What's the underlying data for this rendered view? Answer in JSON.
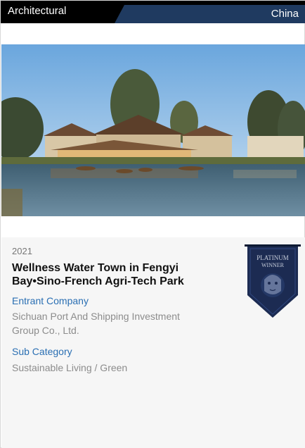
{
  "header": {
    "category": "Architectural",
    "country": "China"
  },
  "entry": {
    "year": "2021",
    "title": "Wellness Water Town in Fengyi Bay•Sino-French Agri-Tech Park",
    "entrant_label": "Entrant Company",
    "entrant_value": "Sichuan Port And Shipping Investment Group Co., Ltd.",
    "subcategory_label": "Sub Category",
    "subcategory_value": "Sustainable Living / Green"
  },
  "badge": {
    "line1": "PLATINUM",
    "line2": "WINNER"
  },
  "colors": {
    "header_bg": "#000000",
    "header_accent": "#1f3a60",
    "label_blue": "#2a6fb3",
    "badge_navy": "#1c2b52"
  }
}
